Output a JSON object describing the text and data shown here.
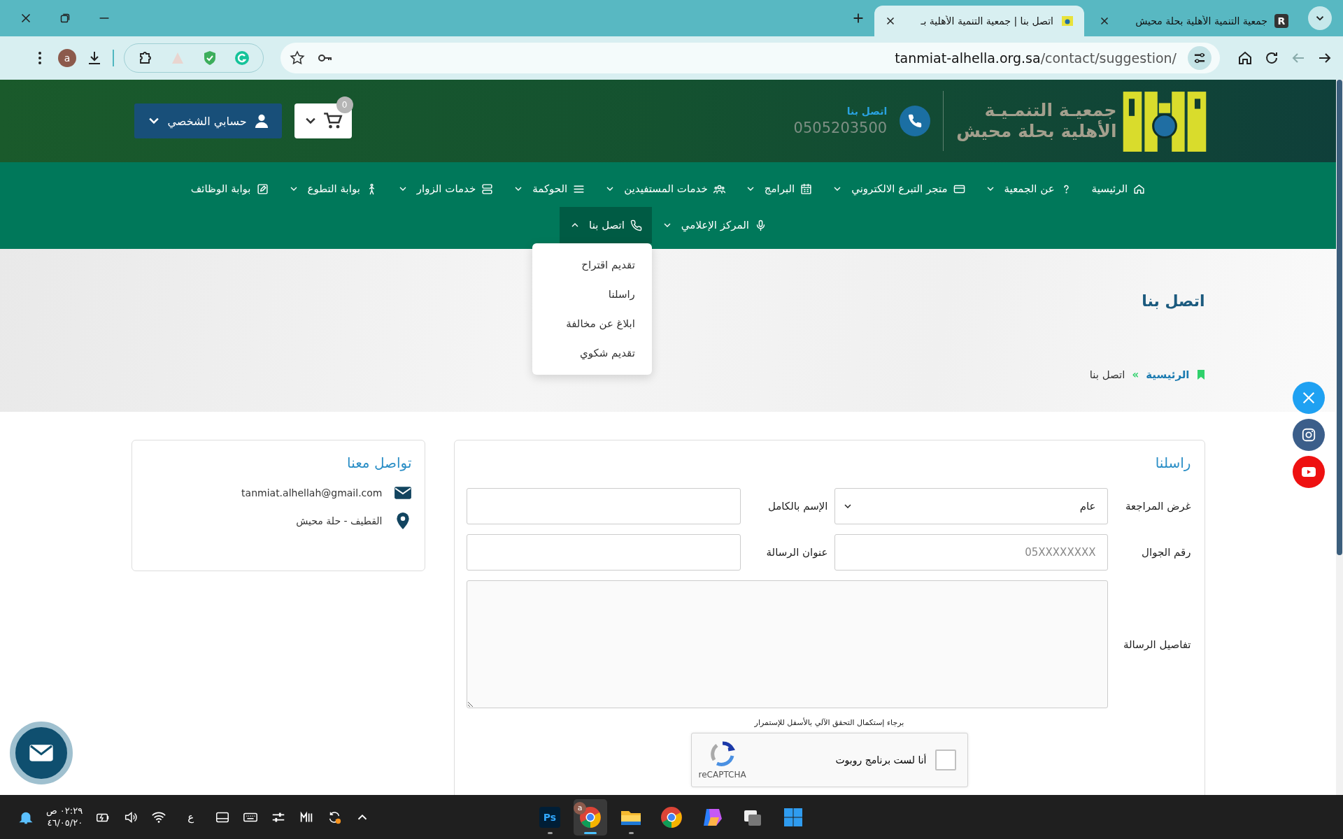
{
  "browser": {
    "tabs": [
      {
        "title": "جمعية التنمية الأهلية بحلة محيش",
        "icon_text": "R",
        "selected": false
      },
      {
        "title": "اتصل بنا | جمعية التنمية الأهلية بـ",
        "selected": true
      }
    ],
    "url_host": "tanmiat-alhella.org.sa",
    "url_path": "/contact/suggestion/",
    "profile_initial": "a"
  },
  "header": {
    "logo_lines": [
      "جمعيـة التنمـيـة",
      "الأهلية بحلة محيش"
    ],
    "contact_label": "اتصل بنا",
    "phone": "0505203500",
    "cart_count": "0",
    "account_label": "حسابي الشخصي"
  },
  "nav": {
    "rows": [
      [
        {
          "label": "الرئيسية"
        },
        {
          "label": "عن الجمعية",
          "expanded": false
        },
        {
          "label": "متجر التبرع الالكتروني",
          "expanded": false
        },
        {
          "label": "البرامج",
          "expanded": false
        },
        {
          "label": "خدمات المستفيدين",
          "expanded": false
        },
        {
          "label": "الحوكمة",
          "expanded": false
        },
        {
          "label": "خدمات الزوار",
          "expanded": false
        },
        {
          "label": "بوابة التطوع",
          "expanded": false
        },
        {
          "label": "بوابة الوظائف"
        }
      ],
      [
        {
          "label": "المركز الإعلامي",
          "expanded": false
        },
        {
          "label": "اتصل بنا",
          "expanded": true,
          "menu": [
            "تقديم اقتراح",
            "راسلنا",
            "ابلاغ عن مخالفة",
            "تقديم شكوي"
          ]
        }
      ]
    ]
  },
  "hero": {
    "title": "اتصل بنا",
    "separator": "»",
    "breadcrumb": [
      {
        "label": "الرئيسية",
        "kind": "link"
      },
      {
        "label": "اتصل بنا",
        "kind": "current"
      }
    ]
  },
  "form": {
    "title": "راسلنا",
    "fields": [
      {
        "label": "غرض المراجعة",
        "kind": "select",
        "value": "عام"
      },
      {
        "label": "الإسم بالكامل",
        "kind": "input"
      },
      {
        "label": "رقم الجوال",
        "kind": "input",
        "placeholder": "05XXXXXXXX"
      },
      {
        "label": "عنوان الرسالة",
        "kind": "input"
      },
      {
        "label": "تفاصيل الرسالة",
        "kind": "textarea"
      }
    ],
    "captcha_note": "برجاء إستكمال التحقق الآلي بالأسفل للإستمرار",
    "captcha": {
      "label": "أنا لست برنامج روبوت",
      "checked": false,
      "brand": "reCAPTCHA"
    }
  },
  "contact_card": {
    "title": "تواصل معنا",
    "items": [
      {
        "kind": "email",
        "text": "tanmiat.alhellah@gmail.com"
      },
      {
        "kind": "location",
        "text": "القطيف - حلة محيش"
      }
    ]
  },
  "social": [
    {
      "kind": "x",
      "color": "#1fa1f2"
    },
    {
      "kind": "instagram",
      "color": "#3b5e8a"
    },
    {
      "kind": "youtube",
      "color": "#ee1111"
    }
  ],
  "taskbar": {
    "time": "٠٢:٢٩ ص",
    "date": "٤٦/٠٥/٢٠",
    "input_language": "ع",
    "apps": [
      {
        "kind": "photoshop",
        "label": "Ps",
        "running": true,
        "selected": false
      },
      {
        "kind": "chrome-profile",
        "badge": "a",
        "running": true,
        "selected": true
      },
      {
        "kind": "explorer",
        "running": true,
        "selected": false
      },
      {
        "kind": "chrome",
        "running": false,
        "selected": false
      },
      {
        "kind": "copilot",
        "running": false,
        "selected": false
      },
      {
        "kind": "task-view",
        "running": false,
        "selected": false
      },
      {
        "kind": "start",
        "running": false,
        "selected": false
      }
    ]
  }
}
